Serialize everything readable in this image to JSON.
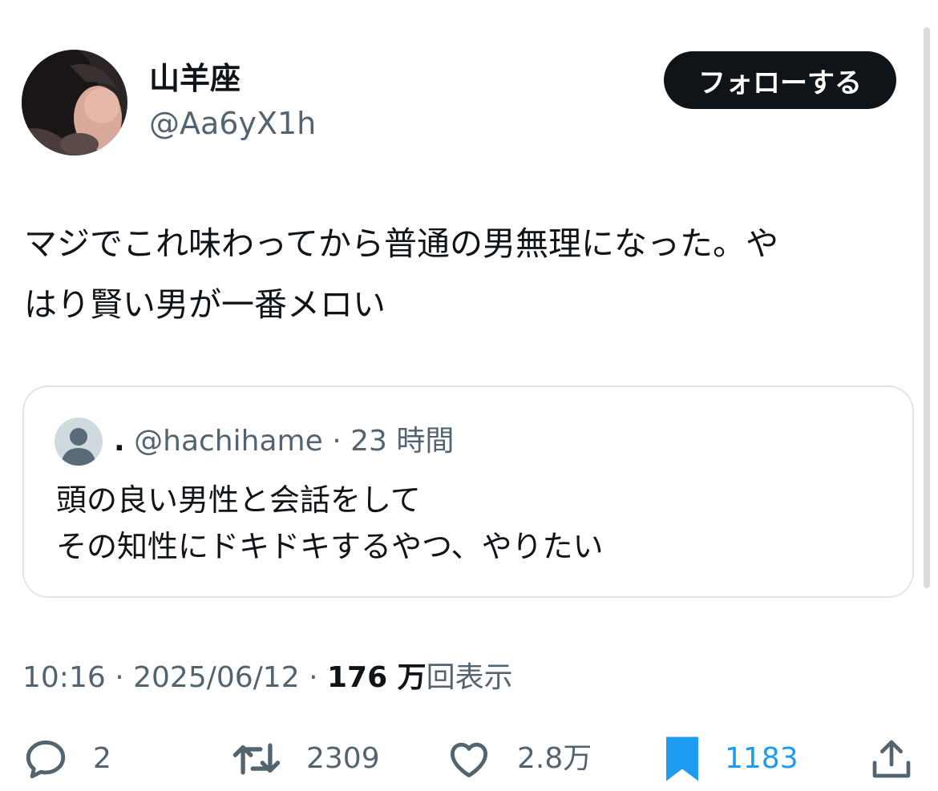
{
  "author": {
    "display_name": "山羊座",
    "handle": "@Aa6yX1h"
  },
  "follow_button_label": "フォローする",
  "tweet": {
    "text_line1": "マジでこれ味わってから普通の男無理になった。や",
    "text_line2": "はり賢い男が一番メロい"
  },
  "quote": {
    "name": ".",
    "handle": "@hachihame",
    "separator": "·",
    "time": "23 時間",
    "text_line1": "頭の良い男性と会話をして",
    "text_line2": "その知性にドキドキするやつ、やりたい"
  },
  "meta": {
    "time": "10:16",
    "separator": "·",
    "date": "2025/06/12",
    "views_count": "176 万",
    "views_label": "回表示"
  },
  "actions": {
    "replies": "2",
    "retweets": "2309",
    "likes": "2.8万",
    "bookmarks": "1183"
  },
  "colors": {
    "text_primary": "#0f1419",
    "text_secondary": "#536471",
    "accent_blue": "#1d9bf0",
    "follow_bg": "#0f1419",
    "card_border": "#e1e5e8"
  },
  "icons": {
    "reply": "speech-bubble-icon",
    "retweet": "retweet-icon",
    "like": "heart-icon",
    "bookmark": "bookmark-filled-icon",
    "share": "share-upload-icon"
  }
}
